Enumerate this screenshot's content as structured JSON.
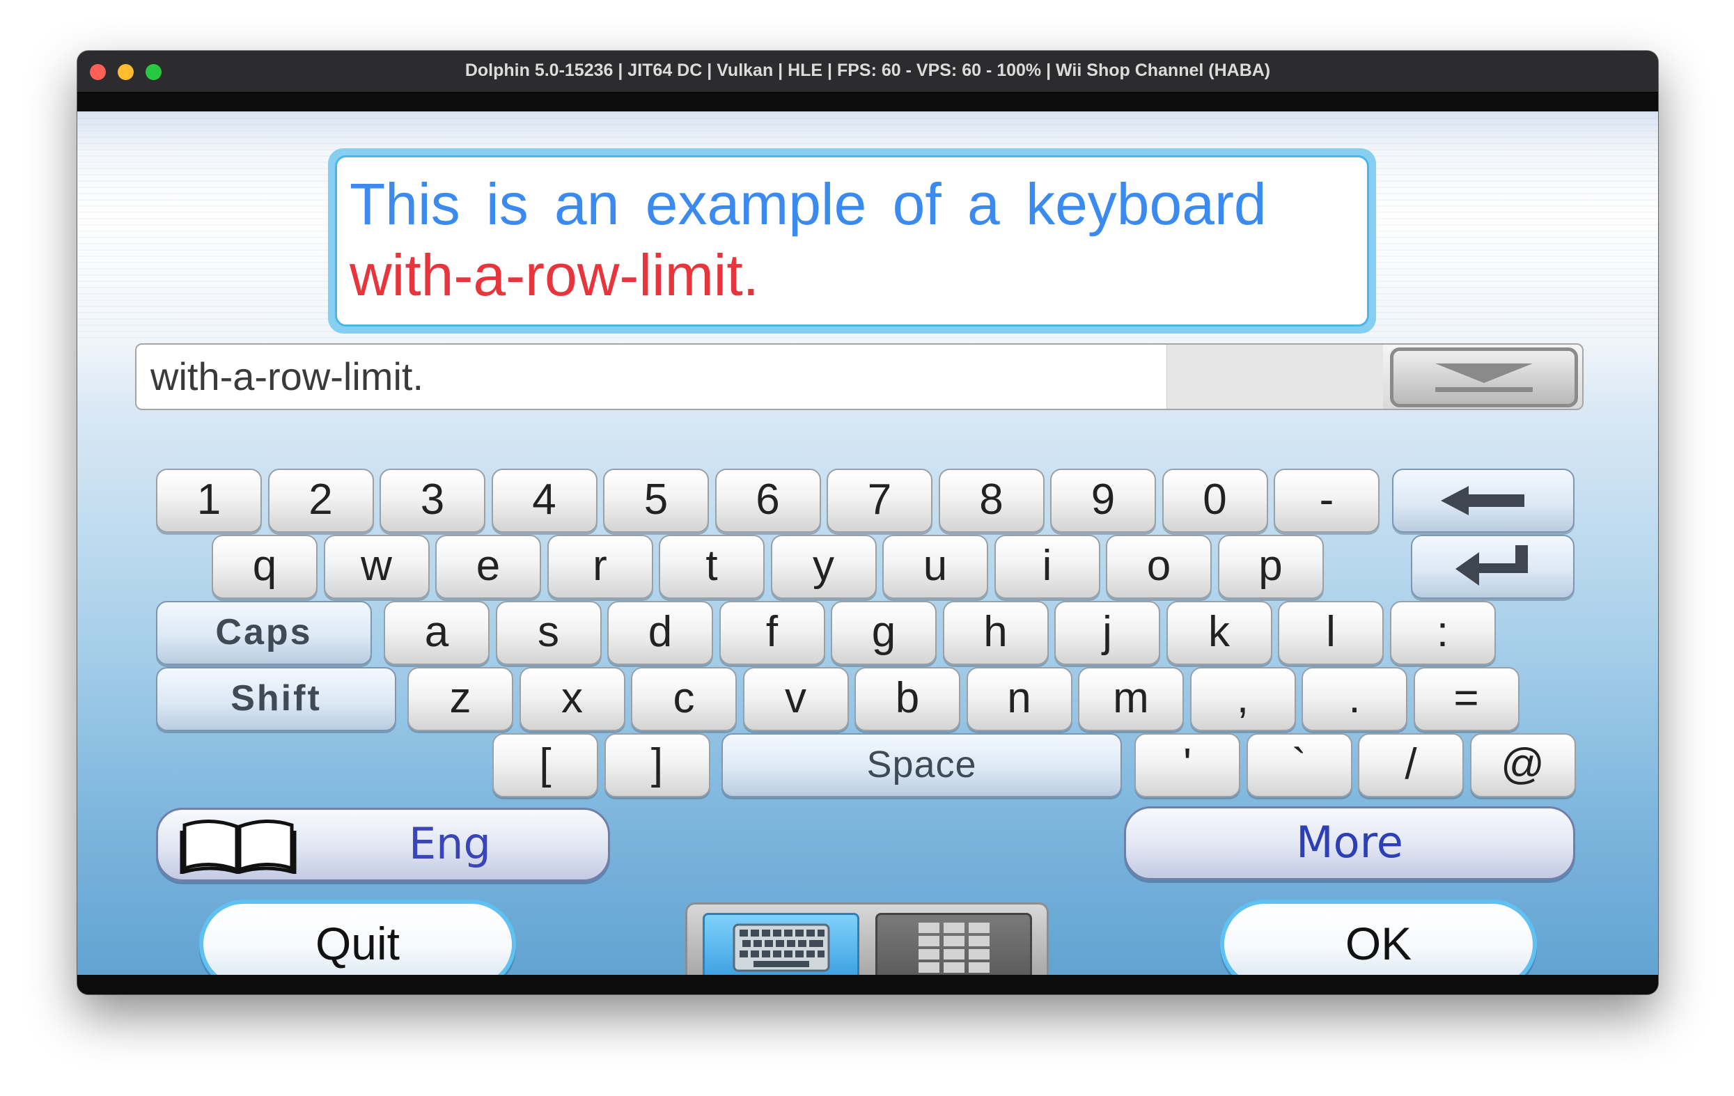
{
  "window": {
    "title": "Dolphin 5.0-15236 | JIT64 DC | Vulkan | HLE | FPS: 60 - VPS: 60 - 100% | Wii Shop Channel (HABA)"
  },
  "message": {
    "line1": "This is an example of a keyboard",
    "line2": "with-a-row-limit.",
    "line1_color": "#3b8af0",
    "line2_color": "#e8343b"
  },
  "input": {
    "value": "with-a-row-limit.",
    "hide_icon": "chevron-down-icon"
  },
  "keyboard": {
    "number_row": [
      "1",
      "2",
      "3",
      "4",
      "5",
      "6",
      "7",
      "8",
      "9",
      "0",
      "-"
    ],
    "backspace_icon": "backspace-arrow-icon",
    "q_row": [
      "q",
      "w",
      "e",
      "r",
      "t",
      "y",
      "u",
      "i",
      "o",
      "p"
    ],
    "enter_icon": "enter-return-icon",
    "caps_label": "Caps",
    "a_row": [
      "a",
      "s",
      "d",
      "f",
      "g",
      "h",
      "j",
      "k",
      "l",
      ":"
    ],
    "shift_label": "Shift",
    "z_row": [
      "z",
      "x",
      "c",
      "v",
      "b",
      "n",
      "m",
      ",",
      ".",
      "="
    ],
    "bottom_left": [
      "[",
      "]"
    ],
    "space_label": "Space",
    "bottom_right": [
      "'",
      "`",
      "/",
      "@"
    ]
  },
  "controls": {
    "language_label": "Eng",
    "language_icon": "book-icon",
    "more_label": "More",
    "quit_label": "Quit",
    "ok_label": "OK",
    "mode_keyboard_icon": "keyboard-icon",
    "mode_grid_icon": "grid-icon"
  }
}
